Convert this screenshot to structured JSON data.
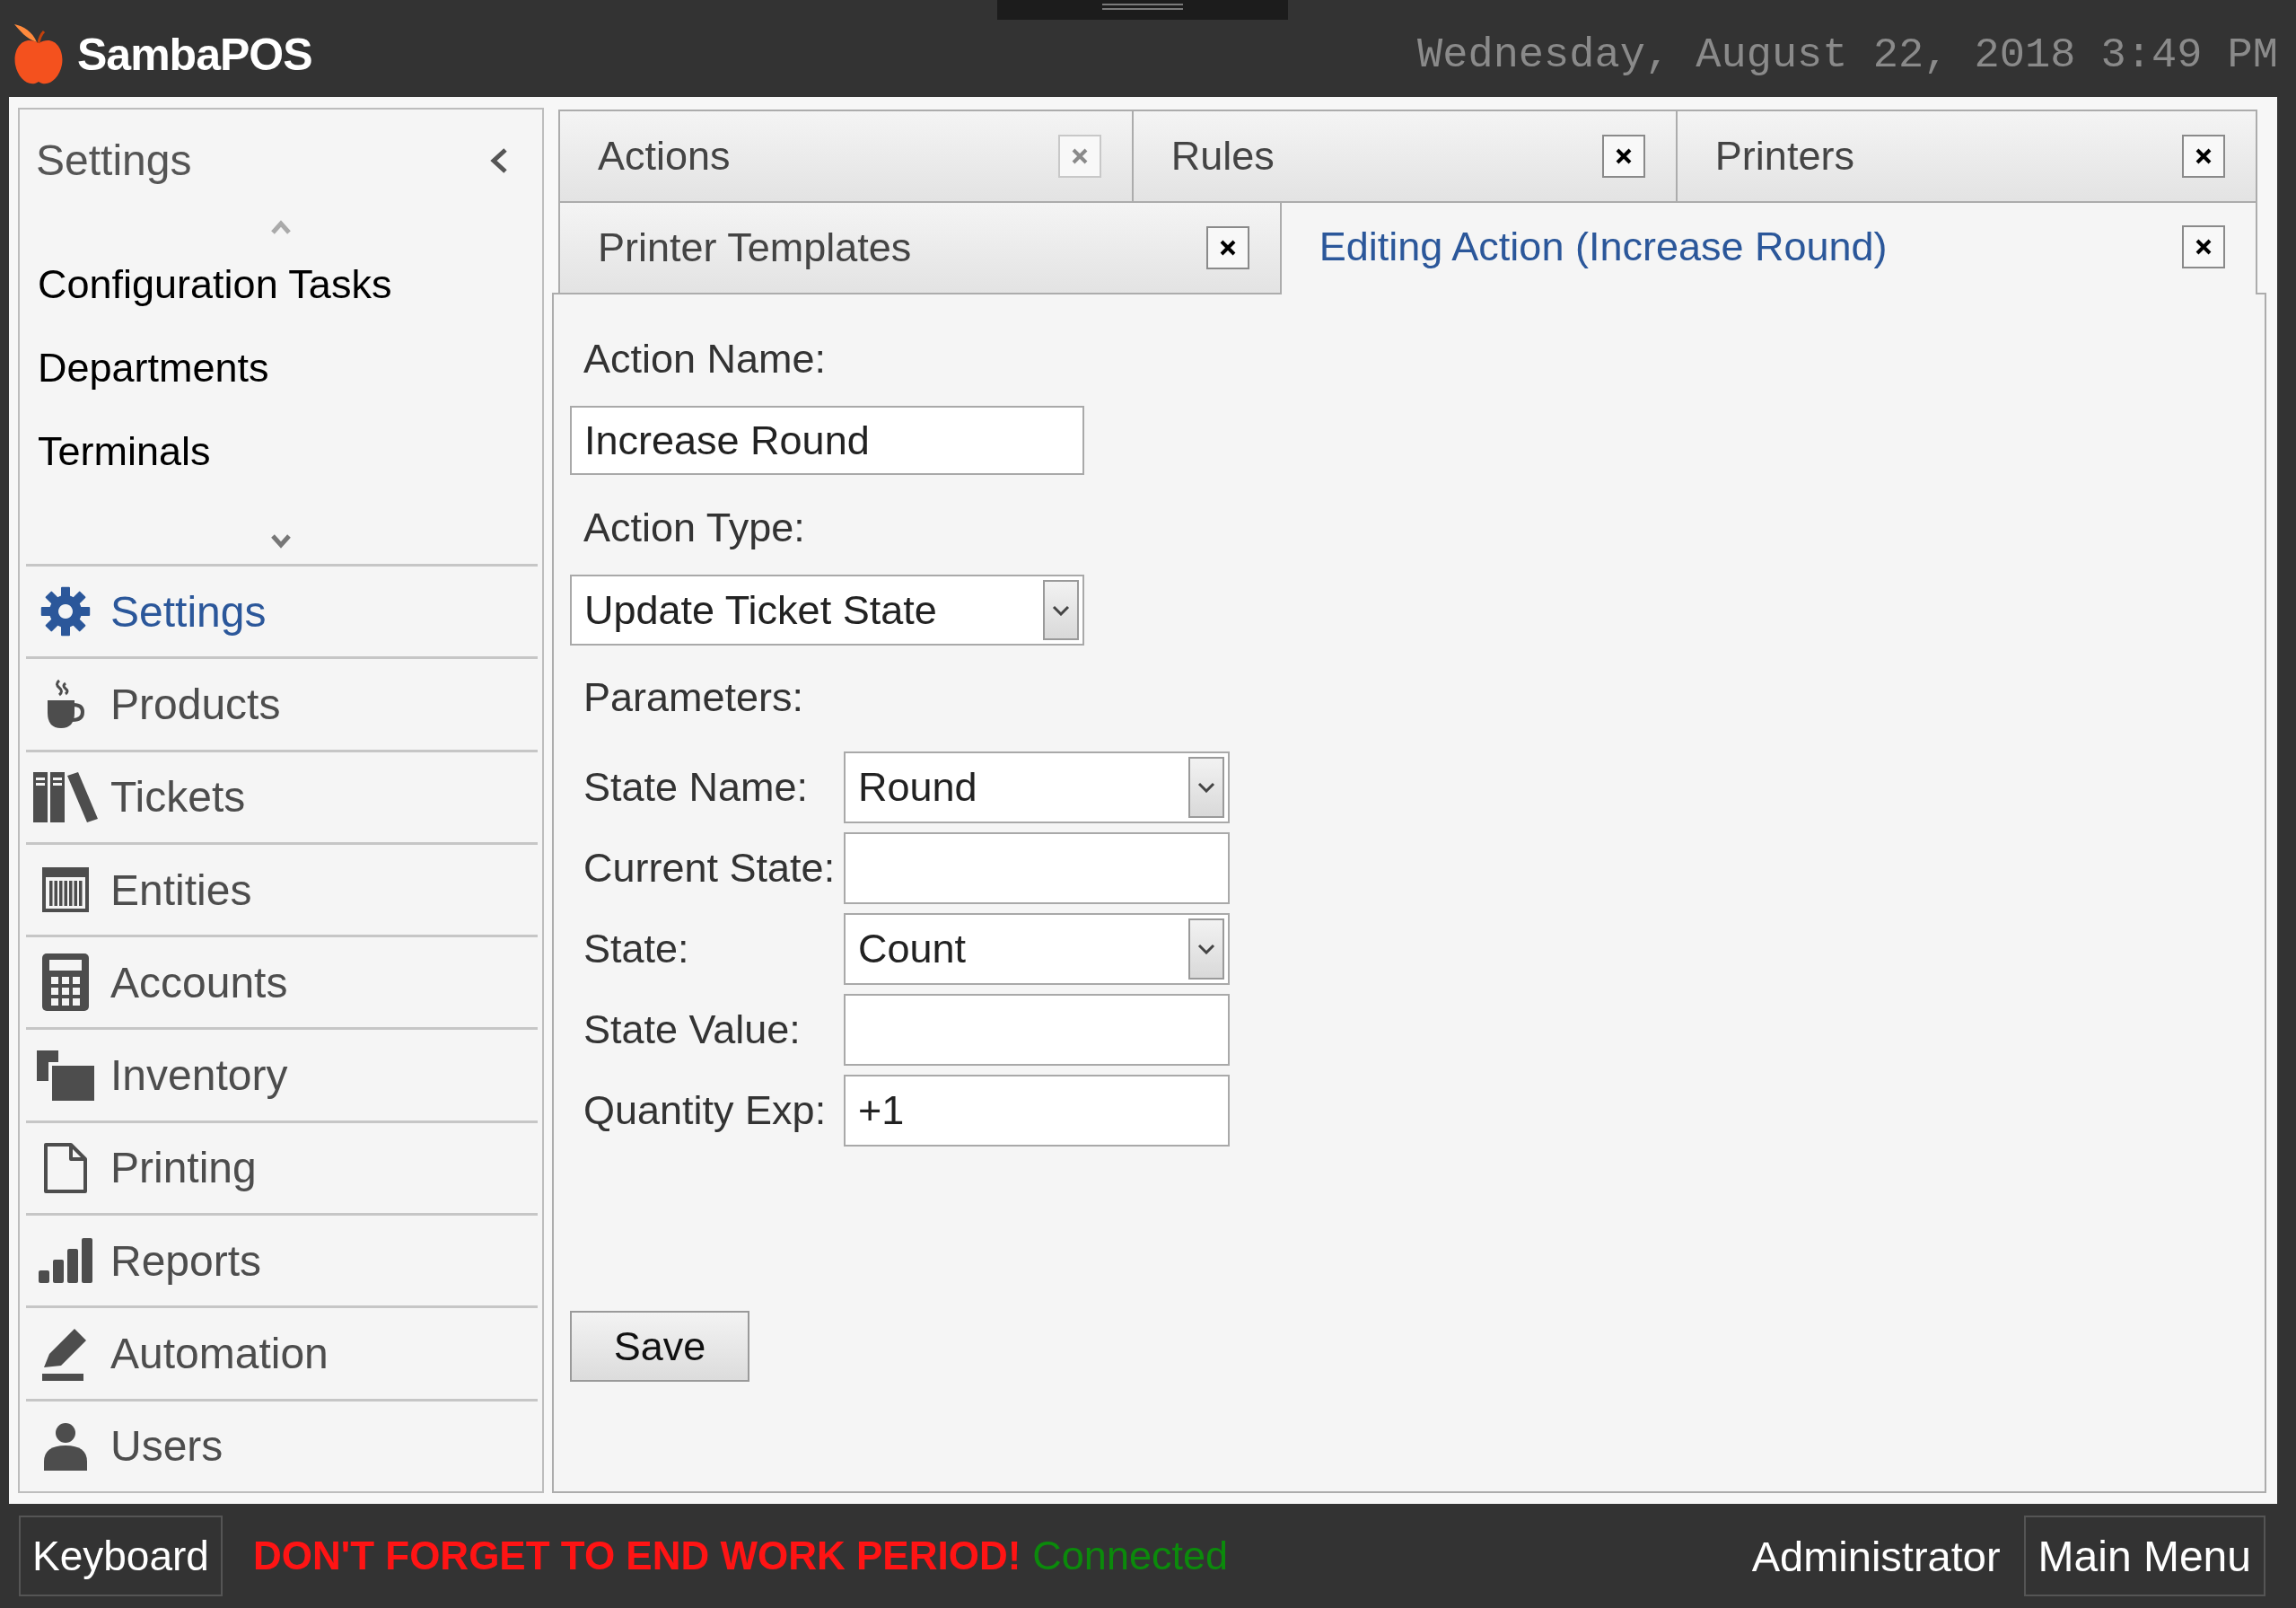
{
  "top_bar": {
    "app_name": "SambaPOS",
    "datetime": "Wednesday, August 22, 2018 3:49 PM"
  },
  "sidebar": {
    "title": "Settings",
    "config_items": [
      "Configuration Tasks",
      "Departments",
      "Terminals"
    ],
    "nav_items": [
      {
        "label": "Settings",
        "selected": true
      },
      {
        "label": "Products",
        "selected": false
      },
      {
        "label": "Tickets",
        "selected": false
      },
      {
        "label": "Entities",
        "selected": false
      },
      {
        "label": "Accounts",
        "selected": false
      },
      {
        "label": "Inventory",
        "selected": false
      },
      {
        "label": "Printing",
        "selected": false
      },
      {
        "label": "Reports",
        "selected": false
      },
      {
        "label": "Automation",
        "selected": false
      },
      {
        "label": "Users",
        "selected": false
      }
    ]
  },
  "tabs": [
    {
      "label": "Actions",
      "selected": false,
      "close_disabled": true
    },
    {
      "label": "Rules",
      "selected": false,
      "close_disabled": false
    },
    {
      "label": "Printers",
      "selected": false,
      "close_disabled": false
    },
    {
      "label": "Printer Templates",
      "selected": false,
      "close_disabled": false
    },
    {
      "label": "Editing Action (Increase Round)",
      "selected": true,
      "close_disabled": false
    }
  ],
  "form": {
    "fields": [
      {
        "kind": "text",
        "label": "Action Name:",
        "value": "Increase Round"
      },
      {
        "kind": "dropdown",
        "label": "Action Type:",
        "value": "Update Ticket State"
      }
    ],
    "parameters_heading": "Parameters:",
    "parameters": [
      {
        "kind": "dropdown",
        "label": "State Name:",
        "value": "Round"
      },
      {
        "kind": "text",
        "label": "Current State:"
      },
      {
        "kind": "dropdown",
        "label": "State:",
        "value": "Count"
      },
      {
        "kind": "text",
        "label": "State Value:"
      },
      {
        "kind": "text",
        "label": "Quantity Exp:",
        "value": "+1"
      }
    ],
    "save_button": "Save"
  },
  "status_bar": {
    "keyboard_button": "Keyboard",
    "warning": "DON'T FORGET TO END WORK PERIOD!",
    "connection_status": "Connected",
    "user": "Administrator",
    "main_menu_button": "Main Menu"
  }
}
